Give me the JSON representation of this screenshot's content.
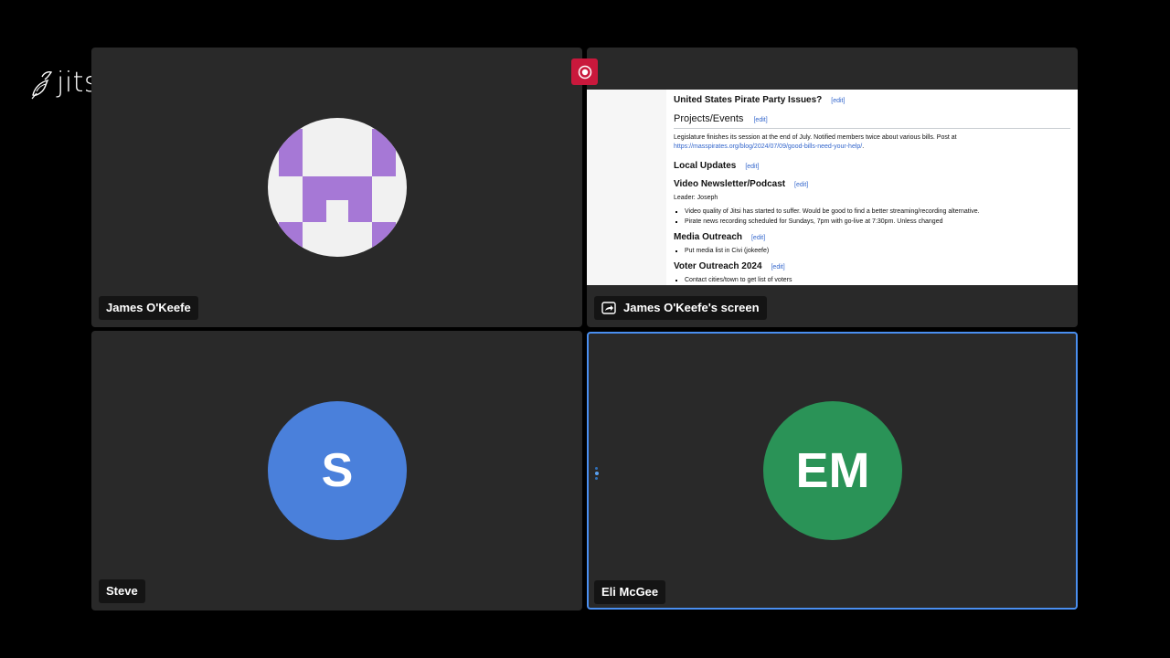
{
  "app": {
    "logo_text": "jitsi"
  },
  "participants": {
    "james": {
      "name": "James O'Keefe"
    },
    "screen": {
      "name": "James O'Keefe's screen"
    },
    "steve": {
      "name": "Steve",
      "initials": "S",
      "color": "#4a80db"
    },
    "eli": {
      "name": "Eli McGee",
      "initials": "EM",
      "color": "#2a9357"
    }
  },
  "recording": {
    "icon": "record-icon"
  },
  "shared_doc": {
    "heading_pirate": "United States Pirate Party Issues?",
    "edit": "[edit]",
    "heading_projects": "Projects/Events",
    "projects_text": "Legislature finishes its session at the end of July. Notified members twice about various bills. Post at",
    "projects_link": "https://masspirates.org/blog/2024/07/09/good-bills-need-your-help/",
    "heading_local": "Local Updates",
    "heading_video": "Video Newsletter/Podcast",
    "video_leader": "Leader: Joseph",
    "video_items": [
      "Video quality of Jitsi has started to suffer. Would be good to find a better streaming/recording alternative.",
      "Pirate news recording scheduled for Sundays, 7pm with go-live at 7:30pm. Unless changed"
    ],
    "heading_media": "Media Outreach",
    "media_items": [
      "Put media list in Civi (jokeefe)"
    ],
    "heading_voter": "Voter Outreach 2024",
    "voter_items": [
      "Contact cities/town to get list of voters"
    ]
  }
}
